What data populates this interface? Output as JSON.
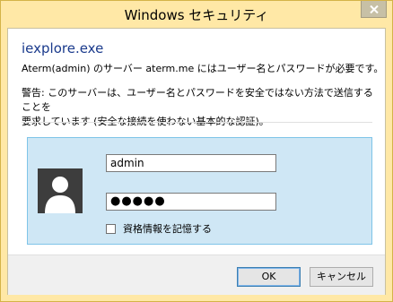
{
  "window": {
    "title": "Windows セキュリティ",
    "close_symbol": "close-icon"
  },
  "dialog": {
    "app_name": "iexplore.exe",
    "message": "Aterm(admin) のサーバー aterm.me にはユーザー名とパスワードが必要です。",
    "warning_line1": "警告: このサーバーは、ユーザー名とパスワードを安全ではない方法で送信することを",
    "warning_line2": "要求しています (安全な接続を使わない基本的な認証)。"
  },
  "credentials": {
    "username_value": "admin",
    "password_value": "●●●●●",
    "remember_label": "資格情報を記憶する",
    "remember_checked": false,
    "avatar_icon": "user-avatar-icon"
  },
  "buttons": {
    "ok_label": "OK",
    "cancel_label": "キャンセル"
  },
  "colors": {
    "titlebar_bg": "#ffe8a6",
    "app_name_color": "#1a3a8c",
    "panel_bg": "#cfe7f5",
    "panel_border": "#7ec4e8",
    "close_btn_bg": "#c7c0a6"
  }
}
